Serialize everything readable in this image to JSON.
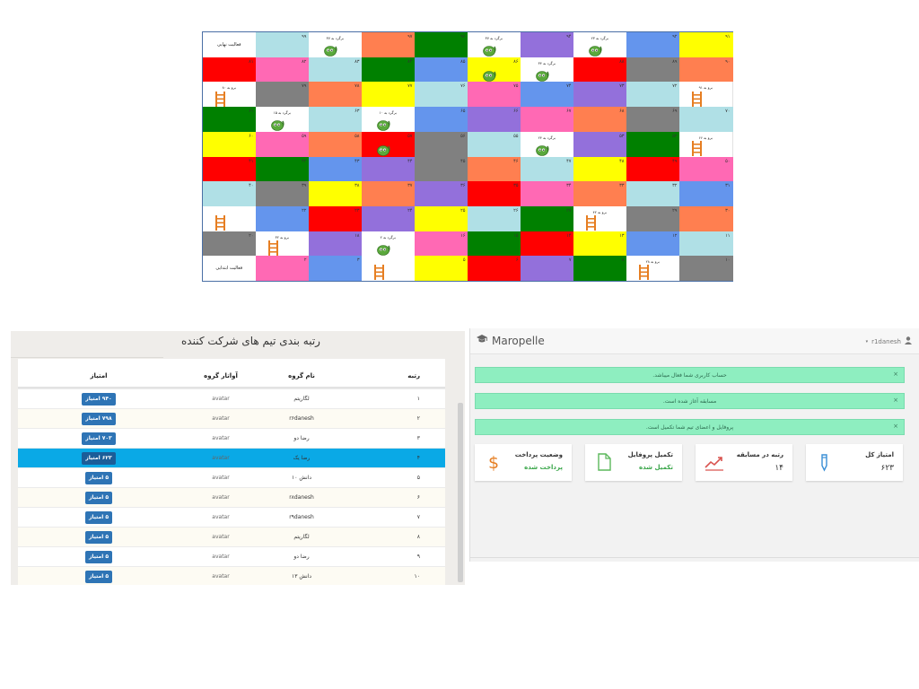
{
  "board": {
    "top_left_label": "فعالیت نهایی",
    "bottom_left_label": "فعالیت ابتدایی",
    "colors": {
      "cyan": "#b0e0e6",
      "orange": "#ff7f50",
      "green": "#008000",
      "purple": "#9370db",
      "blue": "#6495ed",
      "yellow": "#ffff00",
      "red": "#ff0000",
      "pink": "#ff69b4",
      "gray": "#808080",
      "white": "#ffffff"
    },
    "rows": [
      [
        {
          "c": "white",
          "n": "",
          "t": "فعالیت نهایی"
        },
        {
          "c": "cyan",
          "n": "۹۹"
        },
        {
          "c": "white",
          "n": "",
          "s": "snake",
          "note": "برگرد به ۳۷"
        },
        {
          "c": "orange",
          "n": "۹۷"
        },
        {
          "c": "green",
          "n": "۹۶"
        },
        {
          "c": "white",
          "n": "",
          "s": "snake",
          "note": "برگرد به ۳۷"
        },
        {
          "c": "purple",
          "n": "۹۴"
        },
        {
          "c": "white",
          "n": "",
          "s": "snake",
          "note": "برگرد به ۲۳"
        },
        {
          "c": "blue",
          "n": "۹۲"
        },
        {
          "c": "yellow",
          "n": "۹۱"
        }
      ],
      [
        {
          "c": "red",
          "n": "۸۱"
        },
        {
          "c": "pink",
          "n": "۸۲"
        },
        {
          "c": "cyan",
          "n": "۸۳"
        },
        {
          "c": "green",
          "n": "۸۴"
        },
        {
          "c": "blue",
          "n": "۸۵"
        },
        {
          "c": "yellow",
          "n": "۸۶",
          "s": "snake"
        },
        {
          "c": "white",
          "n": "",
          "s": "snake",
          "note": "برگرد به ۳۴"
        },
        {
          "c": "red",
          "n": "۸۸"
        },
        {
          "c": "gray",
          "n": "۸۹"
        },
        {
          "c": "orange",
          "n": "۹۰"
        }
      ],
      [
        {
          "c": "white",
          "n": "",
          "s": "ladder",
          "note": "برو به ۸۰"
        },
        {
          "c": "gray",
          "n": "۷۹"
        },
        {
          "c": "orange",
          "n": "۷۸"
        },
        {
          "c": "yellow",
          "n": "۷۷"
        },
        {
          "c": "cyan",
          "n": "۷۶"
        },
        {
          "c": "pink",
          "n": "۷۵"
        },
        {
          "c": "blue",
          "n": "۷۴"
        },
        {
          "c": "purple",
          "n": "۷۳"
        },
        {
          "c": "cyan",
          "n": "۷۲"
        },
        {
          "c": "white",
          "n": "",
          "s": "ladder",
          "note": "برو به ۹۱"
        }
      ],
      [
        {
          "c": "green",
          "n": "۶۱"
        },
        {
          "c": "white",
          "n": "",
          "s": "snake",
          "note": "برگرد به ۱۵"
        },
        {
          "c": "cyan",
          "n": "۶۳"
        },
        {
          "c": "white",
          "n": "",
          "s": "snake",
          "note": "برگرد به ۱۰"
        },
        {
          "c": "blue",
          "n": "۶۵"
        },
        {
          "c": "purple",
          "n": "۶۶"
        },
        {
          "c": "pink",
          "n": "۶۷"
        },
        {
          "c": "orange",
          "n": "۶۸"
        },
        {
          "c": "gray",
          "n": "۶۹"
        },
        {
          "c": "cyan",
          "n": "۷۰"
        }
      ],
      [
        {
          "c": "yellow",
          "n": "۶۰"
        },
        {
          "c": "pink",
          "n": "۵۹"
        },
        {
          "c": "orange",
          "n": "۵۸"
        },
        {
          "c": "red",
          "n": "۵۷",
          "s": "snake"
        },
        {
          "c": "gray",
          "n": "۵۶"
        },
        {
          "c": "cyan",
          "n": "۵۵"
        },
        {
          "c": "white",
          "n": "",
          "s": "snake",
          "note": "برگرد به ۲۴"
        },
        {
          "c": "purple",
          "n": "۵۳"
        },
        {
          "c": "green",
          "n": "۵۲"
        },
        {
          "c": "white",
          "n": "",
          "s": "ladder",
          "note": "برو به ۶۶"
        }
      ],
      [
        {
          "c": "red",
          "n": "۴۱"
        },
        {
          "c": "green",
          "n": "۴۲"
        },
        {
          "c": "blue",
          "n": "۴۳"
        },
        {
          "c": "purple",
          "n": "۴۴"
        },
        {
          "c": "gray",
          "n": "۴۵"
        },
        {
          "c": "orange",
          "n": "۴۶"
        },
        {
          "c": "cyan",
          "n": "۴۷"
        },
        {
          "c": "yellow",
          "n": "۴۸"
        },
        {
          "c": "red",
          "n": "۴۹"
        },
        {
          "c": "pink",
          "n": "۵۰"
        }
      ],
      [
        {
          "c": "cyan",
          "n": "۴۰"
        },
        {
          "c": "gray",
          "n": "۳۹"
        },
        {
          "c": "yellow",
          "n": "۳۸"
        },
        {
          "c": "orange",
          "n": "۳۷"
        },
        {
          "c": "purple",
          "n": "۳۶"
        },
        {
          "c": "red",
          "n": "۳۵"
        },
        {
          "c": "pink",
          "n": "۳۴"
        },
        {
          "c": "orange",
          "n": "۳۳"
        },
        {
          "c": "cyan",
          "n": "۳۲"
        },
        {
          "c": "blue",
          "n": "۳۱"
        }
      ],
      [
        {
          "c": "white",
          "n": "",
          "s": "ladder"
        },
        {
          "c": "blue",
          "n": "۲۲"
        },
        {
          "c": "red",
          "n": "۲۳"
        },
        {
          "c": "purple",
          "n": "۲۴"
        },
        {
          "c": "yellow",
          "n": "۲۵"
        },
        {
          "c": "cyan",
          "n": "۲۶"
        },
        {
          "c": "green",
          "n": "۲۷"
        },
        {
          "c": "white",
          "n": "",
          "s": "ladder",
          "note": "برو به ۴۲"
        },
        {
          "c": "gray",
          "n": "۲۹"
        },
        {
          "c": "orange",
          "n": "۳۰"
        }
      ],
      [
        {
          "c": "gray",
          "n": "۲۰"
        },
        {
          "c": "white",
          "n": "",
          "s": "ladder",
          "note": "برو به ۳۲"
        },
        {
          "c": "purple",
          "n": "۱۸"
        },
        {
          "c": "white",
          "n": "",
          "s": "snake",
          "note": "برگرد به ۲"
        },
        {
          "c": "pink",
          "n": "۱۶"
        },
        {
          "c": "green",
          "n": "۱۵"
        },
        {
          "c": "red",
          "n": "۱۴"
        },
        {
          "c": "yellow",
          "n": "۱۳"
        },
        {
          "c": "blue",
          "n": "۱۲"
        },
        {
          "c": "cyan",
          "n": "۱۱"
        }
      ],
      [
        {
          "c": "white",
          "n": "",
          "t": "فعالیت ابتدایی"
        },
        {
          "c": "pink",
          "n": "۲"
        },
        {
          "c": "blue",
          "n": "۳"
        },
        {
          "c": "white",
          "n": "",
          "s": "ladder"
        },
        {
          "c": "yellow",
          "n": "۵"
        },
        {
          "c": "red",
          "n": "۶"
        },
        {
          "c": "purple",
          "n": "۷"
        },
        {
          "c": "green",
          "n": "۸"
        },
        {
          "c": "white",
          "n": "",
          "s": "ladder",
          "note": "برو به ۲۸"
        },
        {
          "c": "gray",
          "n": "۱۰"
        }
      ]
    ]
  },
  "ranking": {
    "title": "رتبه بندی تیم های شرکت کننده",
    "headers": {
      "rank": "رتبه",
      "name": "نام گروه",
      "avatar": "آواتار گروه",
      "score": "امتیاز"
    },
    "rows": [
      {
        "rank": "۱",
        "name": "لگاریتم",
        "avatar": "avatar",
        "score": "۹۴۰ امتیاز"
      },
      {
        "rank": "۲",
        "name": "r۶danesh",
        "avatar": "avatar",
        "score": "۷۹۸ امتیاز"
      },
      {
        "rank": "۳",
        "name": "رضا دو",
        "avatar": "avatar",
        "score": "۷۰۳ امتیاز"
      },
      {
        "rank": "۴",
        "name": "رضا یک",
        "avatar": "avatar",
        "score": "۶۲۳ امتیاز",
        "highlight": true
      },
      {
        "rank": "۵",
        "name": "دانش ۱۰",
        "avatar": "avatar",
        "score": "۵ امتیاز"
      },
      {
        "rank": "۶",
        "name": "r۸danesh",
        "avatar": "avatar",
        "score": "۵ امتیاز"
      },
      {
        "rank": "۷",
        "name": "r۹danesh",
        "avatar": "avatar",
        "score": "۵ امتیاز"
      },
      {
        "rank": "۸",
        "name": "لگاریتم",
        "avatar": "avatar",
        "score": "۵ امتیاز"
      },
      {
        "rank": "۹",
        "name": "رضا دو",
        "avatar": "avatar",
        "score": "۵ امتیاز"
      },
      {
        "rank": "۱۰",
        "name": "دانش ۱۳",
        "avatar": "avatar",
        "score": "۵ امتیاز"
      }
    ]
  },
  "dashboard": {
    "brand": "Maropelle",
    "user": "r1danesh",
    "alerts": [
      "حساب کاربری شما فعال میباشد.",
      "مسابقه آغاز شده است.",
      "پروفایل و اعضای تیم شما تکمیل است."
    ],
    "cards": [
      {
        "title": "امتیاز کل",
        "value": "۶۲۳",
        "icon": "pen-icon",
        "green": false
      },
      {
        "title": "رتبه در مسابقه",
        "value": "۱۴",
        "icon": "trend-chart-icon",
        "green": false
      },
      {
        "title": "تکمیل پروفایل",
        "value": "تکمیل شده",
        "icon": "document-icon",
        "green": true
      },
      {
        "title": "وضعیت پرداخت",
        "value": "پرداخت شده",
        "icon": "dollar-icon",
        "green": true
      }
    ],
    "accent": "#e67e22"
  }
}
